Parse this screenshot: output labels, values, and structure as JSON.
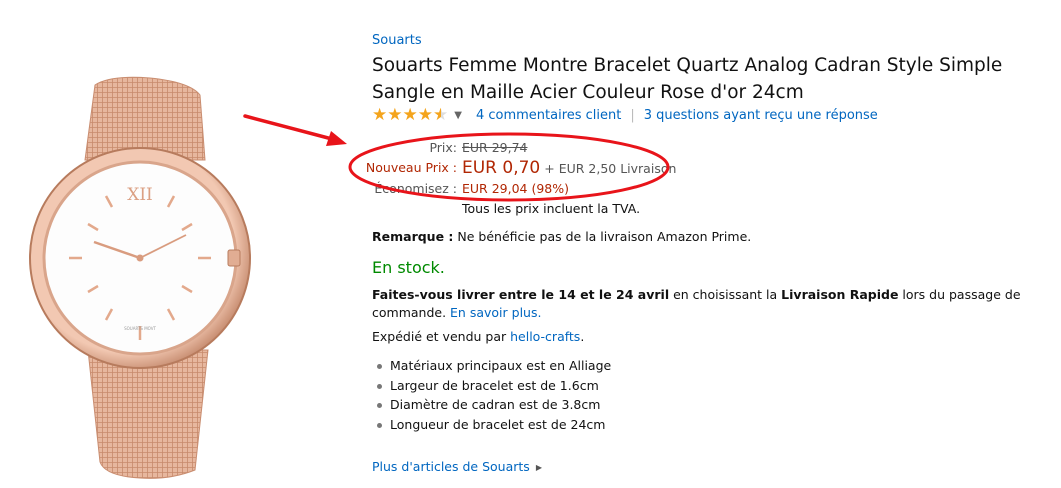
{
  "product": {
    "brand": "Souarts",
    "title": "Souarts Femme Montre Bracelet Quartz Analog Cadran Style Simple Sangle en Maille Acier Couleur Rose d'or 24cm",
    "rating": 4.5,
    "reviews_link": "4 commentaires client",
    "questions_link": "3 questions ayant reçu une réponse"
  },
  "price": {
    "old_label": "Prix:",
    "old_value": "EUR 29,74",
    "new_label": "Nouveau Prix :",
    "new_value": "EUR 0,70",
    "shipping": "+ EUR 2,50 Livraison",
    "save_label": "Économisez :",
    "save_value": "EUR 29,04 (98%)",
    "tva": "Tous les prix incluent la TVA."
  },
  "remark": {
    "label": "Remarque :",
    "text": " Ne bénéficie pas de la livraison Amazon Prime."
  },
  "stock": "En stock.",
  "delivery": {
    "bold1": "Faites-vous livrer entre le 14 et le 24 avril",
    "text1": " en choisissant la ",
    "bold2": "Livraison Rapide",
    "text2": " lors du passage de commande. ",
    "link": "En savoir plus."
  },
  "seller": {
    "text": "Expédié et vendu par ",
    "link": "hello-crafts",
    "suffix": "."
  },
  "features": [
    "Matériaux principaux est en Alliage",
    "Largeur de bracelet est de 1.6cm",
    "Diamètre de cadran est de 3.8cm",
    "Longueur de bracelet est de 24cm"
  ],
  "more_link": "Plus d'articles de Souarts",
  "colors": {
    "link": "#0066c0",
    "price_red": "#b12704",
    "stock_green": "#008a00",
    "star": "#f4a41c",
    "annotation_red": "#e8141a",
    "rose_gold": "#e0a98d"
  },
  "icons": [
    "star-icon",
    "chevron-down-icon",
    "chevron-right-icon",
    "red-arrow-annotation",
    "red-ellipse-annotation",
    "watch-image"
  ]
}
